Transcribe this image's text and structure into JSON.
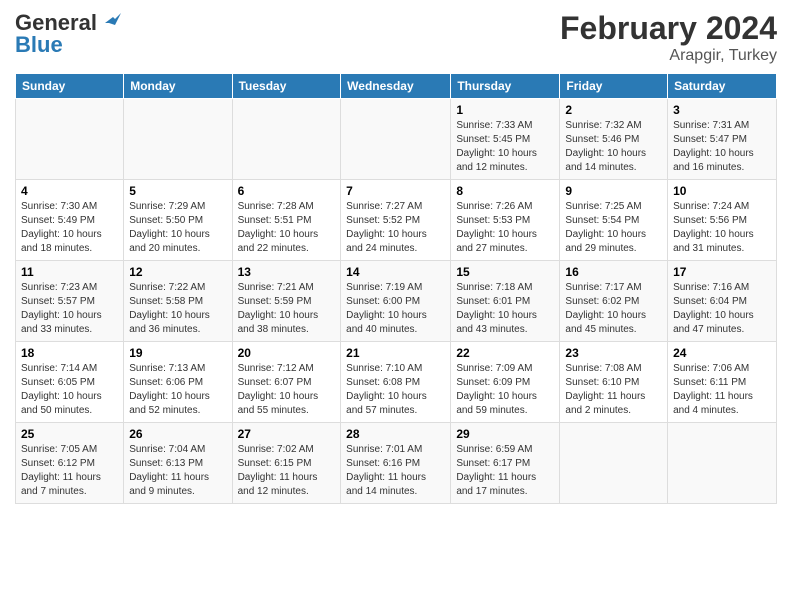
{
  "header": {
    "logo_general": "General",
    "logo_blue": "Blue",
    "title": "February 2024",
    "subtitle": "Arapgir, Turkey"
  },
  "days_of_week": [
    "Sunday",
    "Monday",
    "Tuesday",
    "Wednesday",
    "Thursday",
    "Friday",
    "Saturday"
  ],
  "weeks": [
    [
      {
        "day": "",
        "info": ""
      },
      {
        "day": "",
        "info": ""
      },
      {
        "day": "",
        "info": ""
      },
      {
        "day": "",
        "info": ""
      },
      {
        "day": "1",
        "info": "Sunrise: 7:33 AM\nSunset: 5:45 PM\nDaylight: 10 hours\nand 12 minutes."
      },
      {
        "day": "2",
        "info": "Sunrise: 7:32 AM\nSunset: 5:46 PM\nDaylight: 10 hours\nand 14 minutes."
      },
      {
        "day": "3",
        "info": "Sunrise: 7:31 AM\nSunset: 5:47 PM\nDaylight: 10 hours\nand 16 minutes."
      }
    ],
    [
      {
        "day": "4",
        "info": "Sunrise: 7:30 AM\nSunset: 5:49 PM\nDaylight: 10 hours\nand 18 minutes."
      },
      {
        "day": "5",
        "info": "Sunrise: 7:29 AM\nSunset: 5:50 PM\nDaylight: 10 hours\nand 20 minutes."
      },
      {
        "day": "6",
        "info": "Sunrise: 7:28 AM\nSunset: 5:51 PM\nDaylight: 10 hours\nand 22 minutes."
      },
      {
        "day": "7",
        "info": "Sunrise: 7:27 AM\nSunset: 5:52 PM\nDaylight: 10 hours\nand 24 minutes."
      },
      {
        "day": "8",
        "info": "Sunrise: 7:26 AM\nSunset: 5:53 PM\nDaylight: 10 hours\nand 27 minutes."
      },
      {
        "day": "9",
        "info": "Sunrise: 7:25 AM\nSunset: 5:54 PM\nDaylight: 10 hours\nand 29 minutes."
      },
      {
        "day": "10",
        "info": "Sunrise: 7:24 AM\nSunset: 5:56 PM\nDaylight: 10 hours\nand 31 minutes."
      }
    ],
    [
      {
        "day": "11",
        "info": "Sunrise: 7:23 AM\nSunset: 5:57 PM\nDaylight: 10 hours\nand 33 minutes."
      },
      {
        "day": "12",
        "info": "Sunrise: 7:22 AM\nSunset: 5:58 PM\nDaylight: 10 hours\nand 36 minutes."
      },
      {
        "day": "13",
        "info": "Sunrise: 7:21 AM\nSunset: 5:59 PM\nDaylight: 10 hours\nand 38 minutes."
      },
      {
        "day": "14",
        "info": "Sunrise: 7:19 AM\nSunset: 6:00 PM\nDaylight: 10 hours\nand 40 minutes."
      },
      {
        "day": "15",
        "info": "Sunrise: 7:18 AM\nSunset: 6:01 PM\nDaylight: 10 hours\nand 43 minutes."
      },
      {
        "day": "16",
        "info": "Sunrise: 7:17 AM\nSunset: 6:02 PM\nDaylight: 10 hours\nand 45 minutes."
      },
      {
        "day": "17",
        "info": "Sunrise: 7:16 AM\nSunset: 6:04 PM\nDaylight: 10 hours\nand 47 minutes."
      }
    ],
    [
      {
        "day": "18",
        "info": "Sunrise: 7:14 AM\nSunset: 6:05 PM\nDaylight: 10 hours\nand 50 minutes."
      },
      {
        "day": "19",
        "info": "Sunrise: 7:13 AM\nSunset: 6:06 PM\nDaylight: 10 hours\nand 52 minutes."
      },
      {
        "day": "20",
        "info": "Sunrise: 7:12 AM\nSunset: 6:07 PM\nDaylight: 10 hours\nand 55 minutes."
      },
      {
        "day": "21",
        "info": "Sunrise: 7:10 AM\nSunset: 6:08 PM\nDaylight: 10 hours\nand 57 minutes."
      },
      {
        "day": "22",
        "info": "Sunrise: 7:09 AM\nSunset: 6:09 PM\nDaylight: 10 hours\nand 59 minutes."
      },
      {
        "day": "23",
        "info": "Sunrise: 7:08 AM\nSunset: 6:10 PM\nDaylight: 11 hours\nand 2 minutes."
      },
      {
        "day": "24",
        "info": "Sunrise: 7:06 AM\nSunset: 6:11 PM\nDaylight: 11 hours\nand 4 minutes."
      }
    ],
    [
      {
        "day": "25",
        "info": "Sunrise: 7:05 AM\nSunset: 6:12 PM\nDaylight: 11 hours\nand 7 minutes."
      },
      {
        "day": "26",
        "info": "Sunrise: 7:04 AM\nSunset: 6:13 PM\nDaylight: 11 hours\nand 9 minutes."
      },
      {
        "day": "27",
        "info": "Sunrise: 7:02 AM\nSunset: 6:15 PM\nDaylight: 11 hours\nand 12 minutes."
      },
      {
        "day": "28",
        "info": "Sunrise: 7:01 AM\nSunset: 6:16 PM\nDaylight: 11 hours\nand 14 minutes."
      },
      {
        "day": "29",
        "info": "Sunrise: 6:59 AM\nSunset: 6:17 PM\nDaylight: 11 hours\nand 17 minutes."
      },
      {
        "day": "",
        "info": ""
      },
      {
        "day": "",
        "info": ""
      }
    ]
  ]
}
